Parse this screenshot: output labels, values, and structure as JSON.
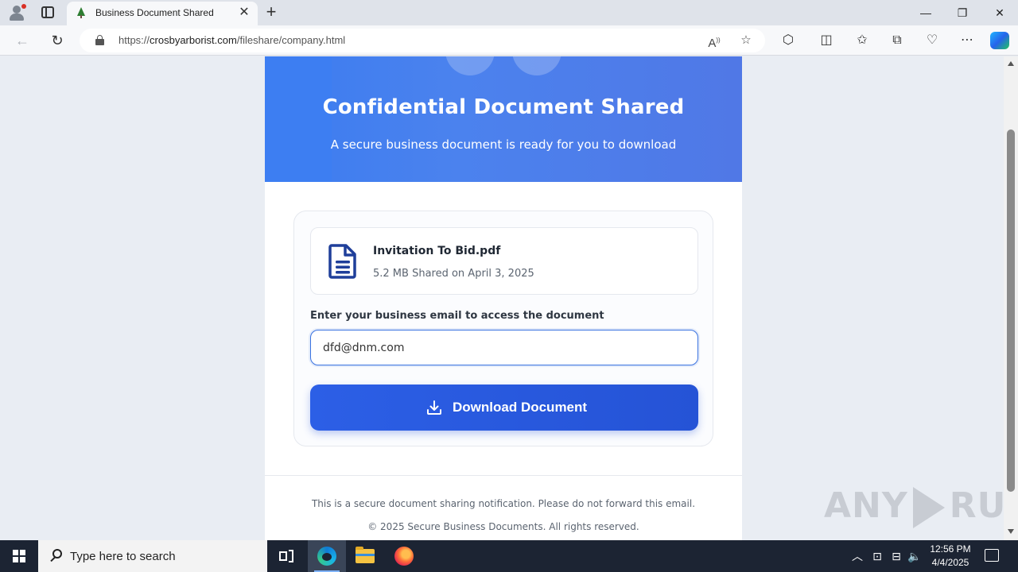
{
  "browser": {
    "tab_title": "Business Document Shared",
    "url_prefix": "https://",
    "url_host": "crosbyarborist.com",
    "url_path": "/fileshare/company.html",
    "window_controls": {
      "minimize": "—",
      "maximize": "❐",
      "close": "✕"
    }
  },
  "page": {
    "hero_title": "Confidential Document Shared",
    "hero_subtitle": "A secure business document is ready for you to download",
    "file": {
      "name": "Invitation To Bid.pdf",
      "meta": "5.2 MB Shared on April 3, 2025",
      "icon": "document-icon"
    },
    "email_label": "Enter your business email to access the document",
    "email_value": "dfd@dnm.com",
    "download_label": "Download Document",
    "footer_notice": "This is a secure document sharing notification. Please do not forward this email.",
    "footer_copyright": "© 2025 Secure Business Documents. All rights reserved.",
    "colors": {
      "hero": "#4b82ee",
      "button": "#2c5fe6",
      "file_icon": "#1f3f9a"
    }
  },
  "watermark": {
    "left": "ANY",
    "right": "RUN"
  },
  "taskbar": {
    "search_placeholder": "Type here to search",
    "time": "12:56 PM",
    "date": "4/4/2025"
  }
}
